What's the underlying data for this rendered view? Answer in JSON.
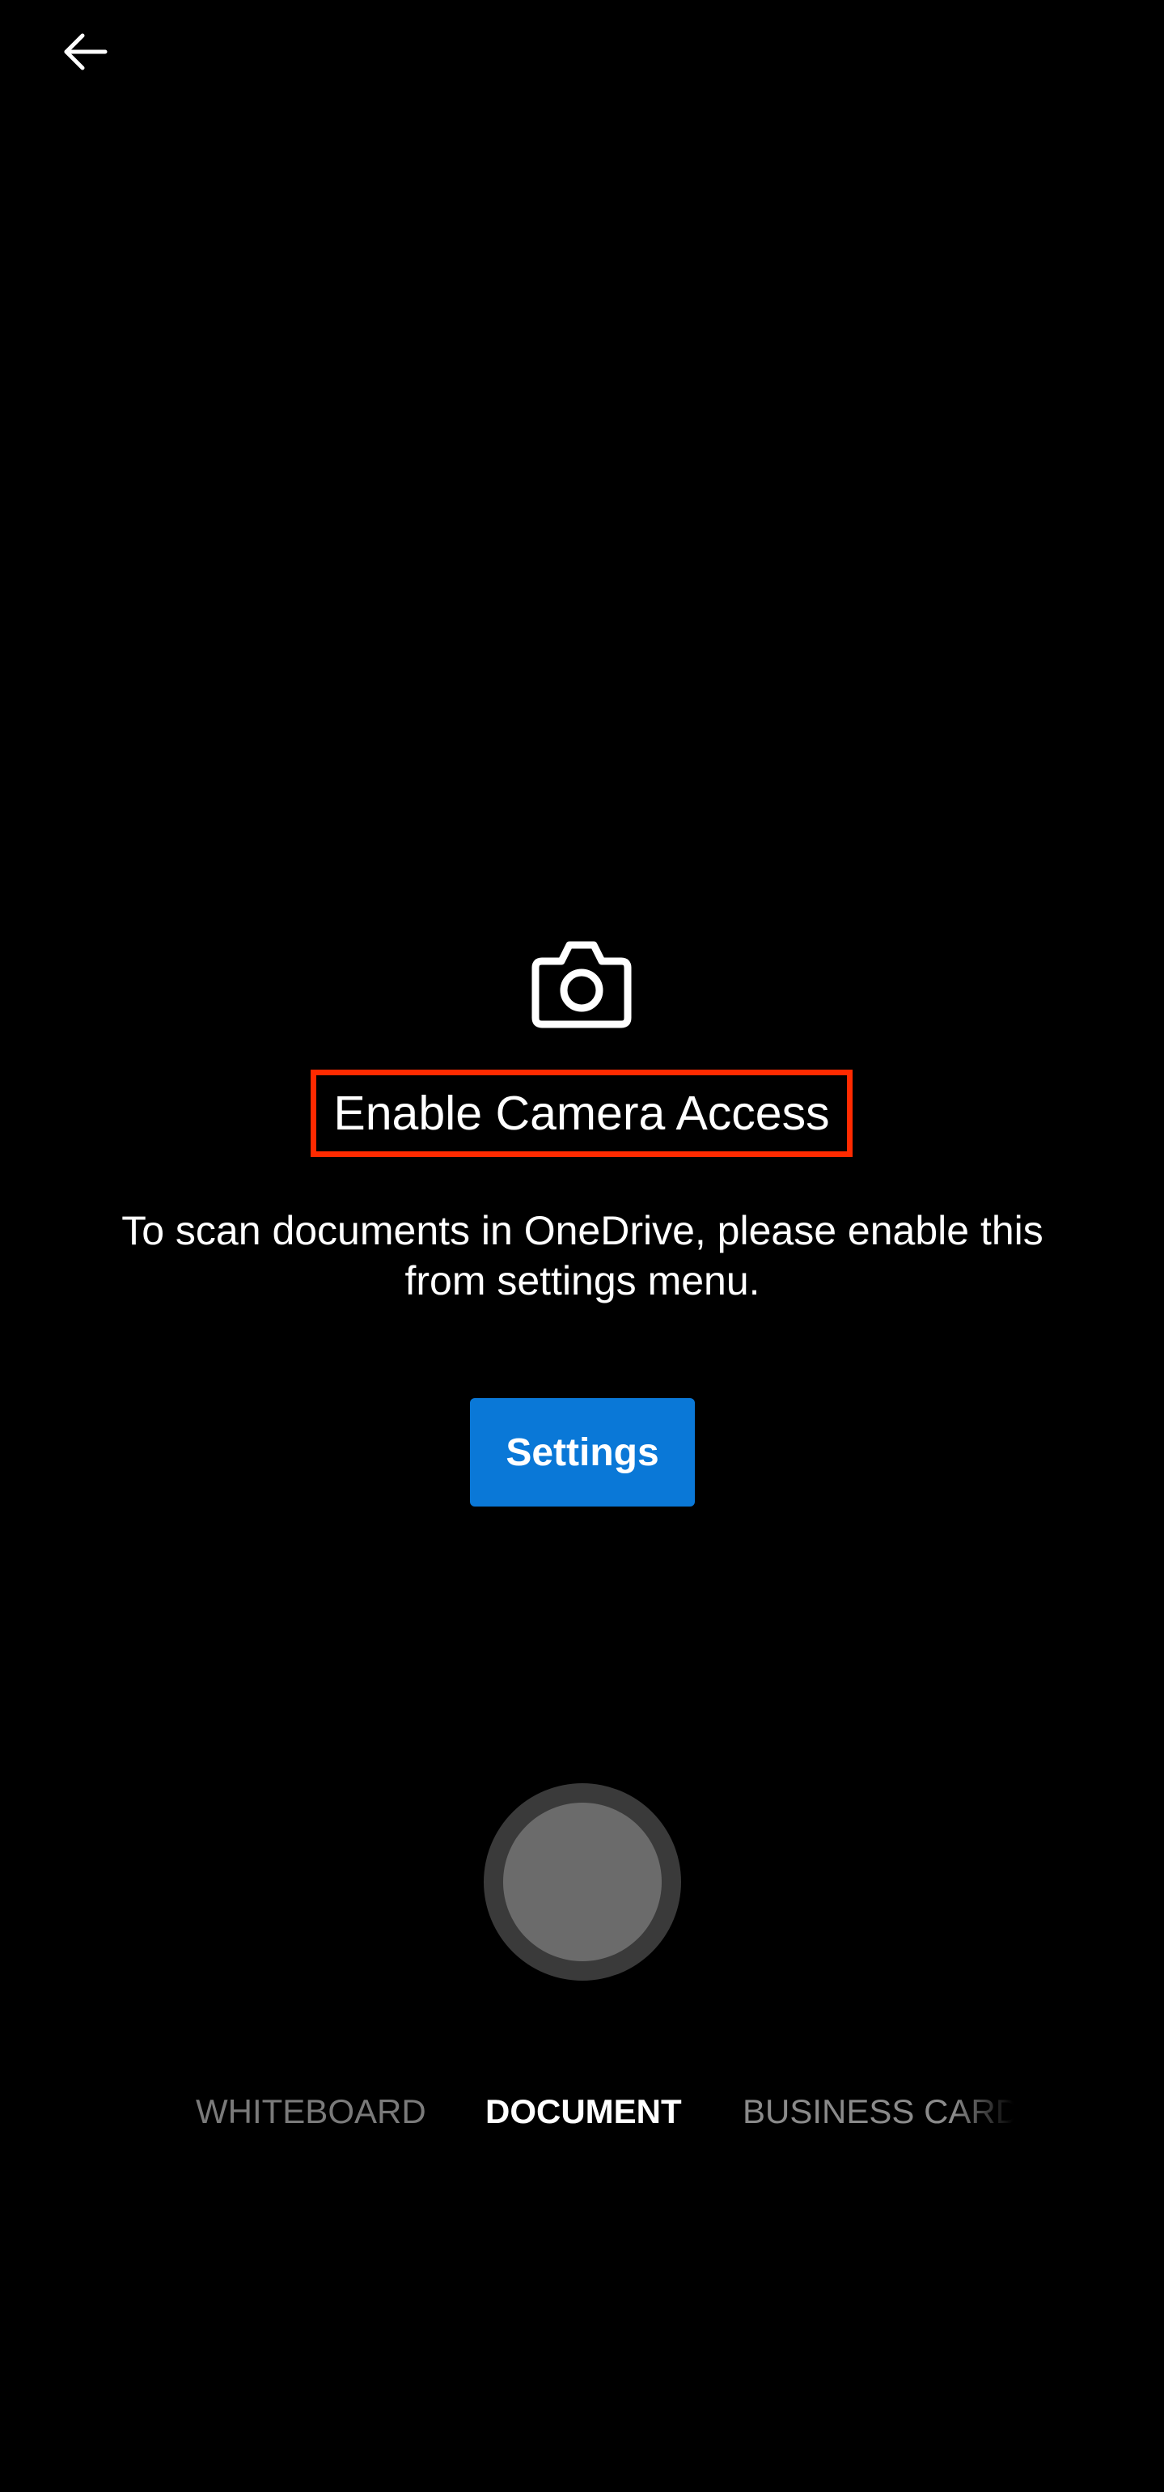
{
  "header": {
    "back_icon": "arrow-left-icon"
  },
  "permission_prompt": {
    "icon": "camera-icon",
    "title": "Enable Camera Access",
    "message_line1": "To scan documents in OneDrive, please enable this",
    "message_line2": "from settings menu.",
    "settings_label": "Settings",
    "highlight_color": "#ff2a00"
  },
  "capture": {
    "shutter_icon": "shutter-circle-icon"
  },
  "modes": {
    "items": [
      "WHITEBOARD",
      "DOCUMENT",
      "BUSINESS CARD"
    ],
    "selected": "DOCUMENT"
  },
  "colors": {
    "background": "#000000",
    "accent": "#0a78d7"
  }
}
